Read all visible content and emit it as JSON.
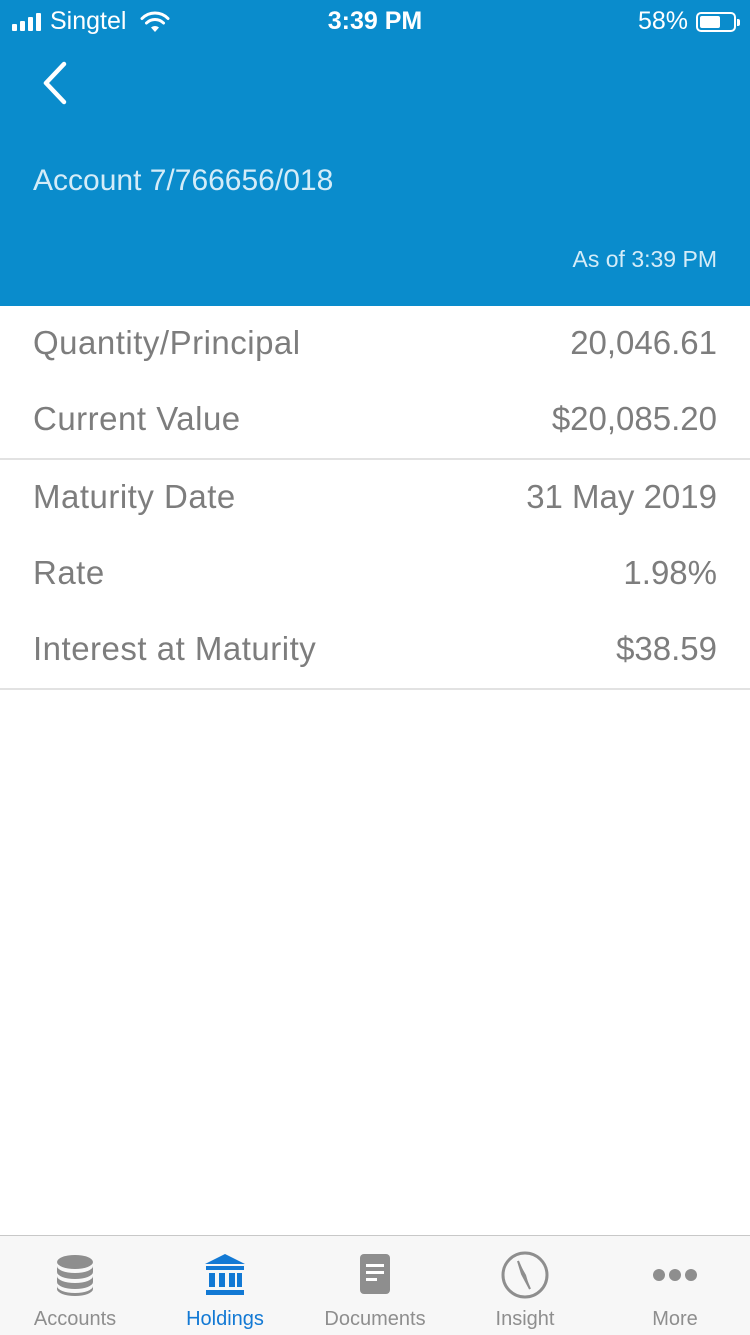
{
  "status_bar": {
    "carrier": "Singtel",
    "time": "3:39 PM",
    "battery": "58%"
  },
  "header": {
    "account_title": "Account 7/766656/018",
    "as_of": "As of 3:39 PM"
  },
  "details": {
    "group1": [
      {
        "label": "Quantity/Principal",
        "value": "20,046.61"
      },
      {
        "label": "Current Value",
        "value": "$20,085.20"
      }
    ],
    "group2": [
      {
        "label": "Maturity Date",
        "value": "31 May 2019"
      },
      {
        "label": "Rate",
        "value": "1.98%"
      },
      {
        "label": "Interest at Maturity",
        "value": "$38.59"
      }
    ]
  },
  "tab_bar": {
    "tabs": [
      {
        "label": "Accounts",
        "icon": "database-icon",
        "active": false
      },
      {
        "label": "Holdings",
        "icon": "bank-icon",
        "active": true
      },
      {
        "label": "Documents",
        "icon": "document-icon",
        "active": false
      },
      {
        "label": "Insight",
        "icon": "compass-icon",
        "active": false
      },
      {
        "label": "More",
        "icon": "more-dots-icon",
        "active": false
      }
    ]
  },
  "colors": {
    "header_bg": "#0a8ccc",
    "active_tab": "#1279d4",
    "inactive_tab": "#8e8e8e"
  }
}
